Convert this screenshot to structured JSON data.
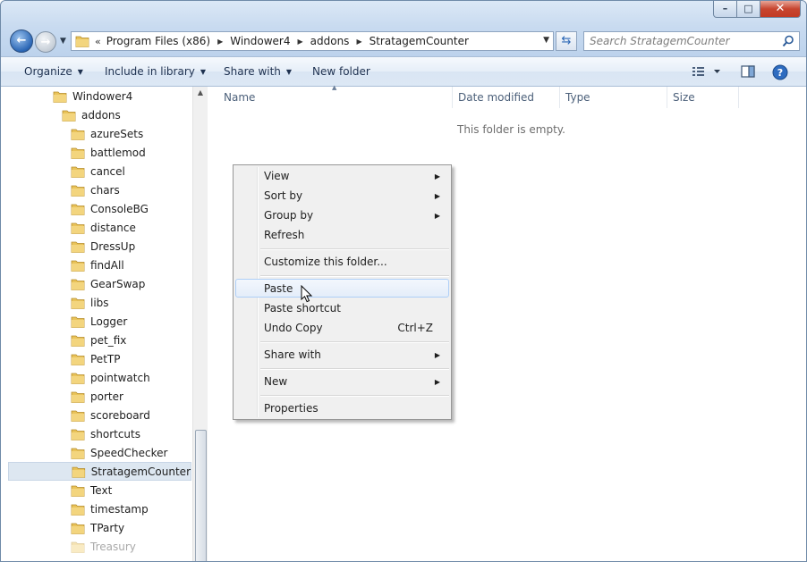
{
  "window": {
    "caption_buttons": {
      "minimize": "–",
      "maximize": "□",
      "close": "✕"
    }
  },
  "address_bar": {
    "overflow": "«",
    "crumbs": [
      "Program Files (x86)",
      "Windower4",
      "addons",
      "StratagemCounter"
    ]
  },
  "search": {
    "placeholder": "Search StratagemCounter"
  },
  "toolbar": {
    "organize": "Organize",
    "include_in_library": "Include in library",
    "share_with": "Share with",
    "new_folder": "New folder"
  },
  "tree": {
    "items": [
      {
        "label": "Windower4"
      },
      {
        "label": "addons"
      },
      {
        "label": "azureSets"
      },
      {
        "label": "battlemod"
      },
      {
        "label": "cancel"
      },
      {
        "label": "chars"
      },
      {
        "label": "ConsoleBG"
      },
      {
        "label": "distance"
      },
      {
        "label": "DressUp"
      },
      {
        "label": "findAll"
      },
      {
        "label": "GearSwap"
      },
      {
        "label": "libs"
      },
      {
        "label": "Logger"
      },
      {
        "label": "pet_fix"
      },
      {
        "label": "PetTP"
      },
      {
        "label": "pointwatch"
      },
      {
        "label": "porter"
      },
      {
        "label": "scoreboard"
      },
      {
        "label": "shortcuts"
      },
      {
        "label": "SpeedChecker"
      },
      {
        "label": "StratagemCounter",
        "selected": true
      },
      {
        "label": "Text"
      },
      {
        "label": "timestamp"
      },
      {
        "label": "TParty"
      },
      {
        "label": "Treasury"
      }
    ]
  },
  "columns": [
    "Name",
    "Date modified",
    "Type",
    "Size"
  ],
  "empty_message": "This folder is empty.",
  "context_menu": {
    "items": [
      {
        "label": "View",
        "submenu": true
      },
      {
        "label": "Sort by",
        "submenu": true
      },
      {
        "label": "Group by",
        "submenu": true
      },
      {
        "label": "Refresh"
      },
      {
        "label": "Customize this folder..."
      },
      {
        "label": "Paste",
        "highlighted": true
      },
      {
        "label": "Paste shortcut"
      },
      {
        "label": "Undo Copy",
        "shortcut": "Ctrl+Z"
      },
      {
        "label": "Share with",
        "submenu": true
      },
      {
        "label": "New",
        "submenu": true
      },
      {
        "label": "Properties"
      }
    ]
  },
  "icons": {
    "folder_color": "#e9c35a",
    "accent": "#2a66b5"
  }
}
